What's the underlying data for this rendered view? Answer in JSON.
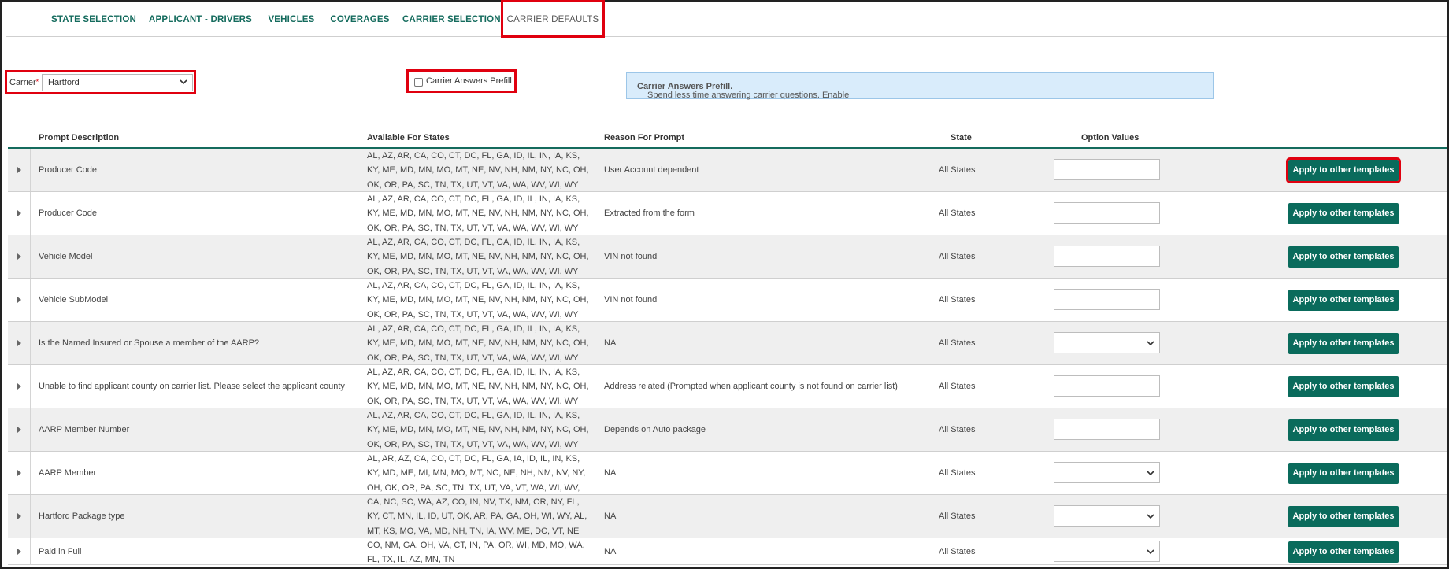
{
  "tabs": [
    {
      "label": "STATE SELECTION",
      "active": false
    },
    {
      "label": "APPLICANT - DRIVERS",
      "active": false
    },
    {
      "label": "VEHICLES",
      "active": false
    },
    {
      "label": "COVERAGES",
      "active": false
    },
    {
      "label": "CARRIER SELECTION",
      "active": false
    },
    {
      "label": "CARRIER DEFAULTS",
      "active": true
    }
  ],
  "carrier": {
    "label": "Carrier",
    "required_mark": "*",
    "value": "Hartford"
  },
  "prefill": {
    "label": "Carrier Answers Prefill",
    "checked": false
  },
  "banner": {
    "text": "Spend less time answering carrier questions. Enable ",
    "bold": "Carrier Answers Prefill."
  },
  "table": {
    "headers": {
      "prompt": "Prompt Description",
      "states": "Available For States",
      "reason": "Reason For Prompt",
      "state": "State",
      "options": "Option Values"
    },
    "apply_label": "Apply to other templates",
    "rows": [
      {
        "prompt": "Producer Code",
        "states": "AL, AZ, AR, CA, CO, CT, DC, FL, GA, ID, IL, IN, IA, KS, KY, ME, MD, MN, MO, MT, NE, NV, NH, NM, NY, NC, OH, OK, OR, PA, SC, TN, TX, UT, VT, VA, WA, WV, WI, WY",
        "reason": "User Account dependent",
        "state": "All States",
        "option_type": "text"
      },
      {
        "prompt": "Producer Code",
        "states": "AL, AZ, AR, CA, CO, CT, DC, FL, GA, ID, IL, IN, IA, KS, KY, ME, MD, MN, MO, MT, NE, NV, NH, NM, NY, NC, OH, OK, OR, PA, SC, TN, TX, UT, VT, VA, WA, WV, WI, WY",
        "reason": "Extracted from the form",
        "state": "All States",
        "option_type": "text"
      },
      {
        "prompt": "Vehicle Model",
        "states": "AL, AZ, AR, CA, CO, CT, DC, FL, GA, ID, IL, IN, IA, KS, KY, ME, MD, MN, MO, MT, NE, NV, NH, NM, NY, NC, OH, OK, OR, PA, SC, TN, TX, UT, VT, VA, WA, WV, WI, WY",
        "reason": "VIN not found",
        "state": "All States",
        "option_type": "text"
      },
      {
        "prompt": "Vehicle SubModel",
        "states": "AL, AZ, AR, CA, CO, CT, DC, FL, GA, ID, IL, IN, IA, KS, KY, ME, MD, MN, MO, MT, NE, NV, NH, NM, NY, NC, OH, OK, OR, PA, SC, TN, TX, UT, VT, VA, WA, WV, WI, WY",
        "reason": "VIN not found",
        "state": "All States",
        "option_type": "text"
      },
      {
        "prompt": "Is the Named Insured or Spouse a member of the AARP?",
        "states": "AL, AZ, AR, CA, CO, CT, DC, FL, GA, ID, IL, IN, IA, KS, KY, ME, MD, MN, MO, MT, NE, NV, NH, NM, NY, NC, OH, OK, OR, PA, SC, TN, TX, UT, VT, VA, WA, WV, WI, WY",
        "reason": "NA",
        "state": "All States",
        "option_type": "select"
      },
      {
        "prompt": "Unable to find applicant county on carrier list. Please select the applicant county",
        "states": "AL, AZ, AR, CA, CO, CT, DC, FL, GA, ID, IL, IN, IA, KS, KY, ME, MD, MN, MO, MT, NE, NV, NH, NM, NY, NC, OH, OK, OR, PA, SC, TN, TX, UT, VT, VA, WA, WV, WI, WY",
        "reason": "Address related (Prompted when applicant county is not found on carrier list)",
        "state": "All States",
        "option_type": "text"
      },
      {
        "prompt": "AARP Member Number",
        "states": "AL, AZ, AR, CA, CO, CT, DC, FL, GA, ID, IL, IN, IA, KS, KY, ME, MD, MN, MO, MT, NE, NV, NH, NM, NY, NC, OH, OK, OR, PA, SC, TN, TX, UT, VT, VA, WA, WV, WI, WY",
        "reason": "Depends on Auto package",
        "state": "All States",
        "option_type": "text"
      },
      {
        "prompt": "AARP Member",
        "states": "AL, AR, AZ, CA, CO, CT, DC, FL, GA, IA, ID, IL, IN, KS, KY, MD, ME, MI, MN, MO, MT, NC, NE, NH, NM, NV, NY, OH, OK, OR, PA, SC, TN, TX, UT, VA, VT, WA, WI, WV, WY",
        "reason": "NA",
        "state": "All States",
        "option_type": "select"
      },
      {
        "prompt": "Hartford Package type",
        "states": "CA, NC, SC, WA, AZ, CO, IN, NV, TX, NM, OR, NY, FL, KY, CT, MN, IL, ID, UT, OK, AR, PA, GA, OH, WI, WY, AL, MT, KS, MO, VA, MD, NH, TN, IA, WV, ME, DC, VT, NE",
        "reason": "NA",
        "state": "All States",
        "option_type": "select"
      },
      {
        "prompt": "Paid in Full",
        "states": "CO, NM, GA, OH, VA, CT, IN, PA, OR, WI, MD, MO, WA, FL, TX, IL, AZ, MN, TN",
        "reason": "NA",
        "state": "All States",
        "option_type": "select"
      }
    ]
  },
  "colors": {
    "accent": "#0a6b5c",
    "highlight": "#e0000f",
    "banner_bg": "#d9ecfb"
  }
}
